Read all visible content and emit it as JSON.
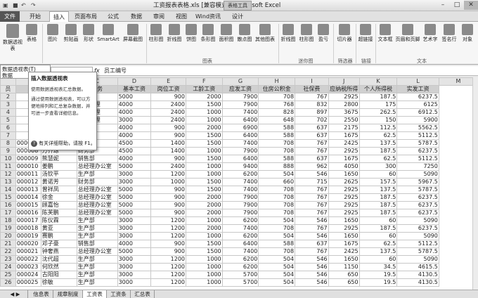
{
  "title": {
    "text": "工资报表表格.xls [兼容模式] - Microsoft Excel",
    "context": "表格工具"
  },
  "window": {
    "min": "–",
    "max": "□",
    "close": "✕"
  },
  "tabs": [
    "文件",
    "开始",
    "插入",
    "页面布局",
    "公式",
    "数据",
    "审阅",
    "视图",
    "Wind资讯",
    "设计"
  ],
  "ribbon": {
    "buttons": [
      "数据透视表",
      "表格",
      "图片",
      "剪贴画",
      "形状",
      "SmartArt",
      "屏幕截图",
      "柱形图",
      "折线图",
      "饼图",
      "条形图",
      "面积图",
      "散点图",
      "其他图表",
      "折线图",
      "柱形图",
      "盈亏",
      "切片器",
      "超链接",
      "文本框",
      "页眉和页脚",
      "艺术字",
      "签名行",
      "对象"
    ],
    "groups": [
      "图表",
      "迷你图",
      "筛选器",
      "链接",
      "文本"
    ]
  },
  "pivot_menu": {
    "item1": "数据透视表(T)",
    "item2": "数据"
  },
  "tooltip": {
    "title": "插入数据透视表",
    "l1": "使用数据透视表汇总数据。",
    "l2": "通过使用数据透视表，可以方便地排列和汇总复杂数据，并可进一步查看详细信息。",
    "help": "有关详细帮助，请按 F1。"
  },
  "formula": {
    "name_box": "",
    "fx": "fx",
    "value": "员工编号"
  },
  "columns": [
    "C",
    "D",
    "E",
    "F",
    "G",
    "H",
    "I",
    "J",
    "K",
    "L",
    "M"
  ],
  "headers": [
    "员",
    "",
    "所属部门",
    "职务",
    "基本工资",
    "岗位工资",
    "工龄工资",
    "应发工资",
    "住房公积金",
    "社保费",
    "应纳税所得",
    "个人所得税",
    "实发工资"
  ],
  "rows": [
    [
      "1",
      "",
      "",
      "",
      "",
      "",
      "",
      "",
      "",
      "",
      "",
      "",
      ""
    ],
    [
      "2",
      "",
      "总经理办公室",
      "文员",
      "5000",
      "900",
      "2000",
      "7900",
      "708",
      "767",
      "2925",
      "187.5",
      "6237.5"
    ],
    [
      "3",
      "",
      "",
      "部门经理",
      "4000",
      "2400",
      "1500",
      "7900",
      "768",
      "832",
      "2800",
      "175",
      "6125"
    ],
    [
      "4",
      "",
      "",
      "部门经理",
      "4000",
      "2400",
      "1000",
      "7400",
      "828",
      "897",
      "3675",
      "262.5",
      "6912.5"
    ],
    [
      "5",
      "",
      "",
      "部门经理",
      "3000",
      "2400",
      "1000",
      "6400",
      "648",
      "702",
      "2550",
      "150",
      "5900"
    ],
    [
      "6",
      "",
      "",
      "销售员",
      "4000",
      "900",
      "2000",
      "6900",
      "588",
      "637",
      "2175",
      "112.5",
      "5562.5"
    ],
    [
      "7",
      "",
      "",
      "销售员",
      "4000",
      "900",
      "1500",
      "6400",
      "588",
      "637",
      "1675",
      "62.5",
      "5112.5"
    ],
    [
      "8",
      "000007",
      "陈明",
      "财务部",
      "4500",
      "1400",
      "1500",
      "7400",
      "708",
      "767",
      "2425",
      "137.5",
      "5787.5"
    ],
    [
      "9",
      "000008",
      "万齐琼",
      "财务部",
      "4500",
      "1400",
      "1000",
      "7900",
      "708",
      "767",
      "2925",
      "187.5",
      "6237.5"
    ],
    [
      "10",
      "000009",
      "熊慧妮",
      "销售部",
      "4000",
      "900",
      "1500",
      "6400",
      "588",
      "637",
      "1675",
      "62.5",
      "5112.5"
    ],
    [
      "11",
      "000010",
      "姜鹏",
      "总经理办公室",
      "5000",
      "2400",
      "1000",
      "9400",
      "888",
      "962",
      "4050",
      "300",
      "7250"
    ],
    [
      "12",
      "000011",
      "汤钦平",
      "生产部",
      "3000",
      "1200",
      "1000",
      "6200",
      "504",
      "546",
      "1650",
      "60",
      "5090"
    ],
    [
      "13",
      "000012",
      "黄诺芳",
      "财务部",
      "3000",
      "1000",
      "1500",
      "7400",
      "660",
      "715",
      "2625",
      "157.5",
      "5967.5"
    ],
    [
      "14",
      "000013",
      "曾祥凤",
      "总经理办公室",
      "5000",
      "900",
      "1500",
      "7400",
      "708",
      "767",
      "2925",
      "137.5",
      "5787.5"
    ],
    [
      "15",
      "000014",
      "徐金",
      "总经理办公室",
      "5000",
      "900",
      "2000",
      "7900",
      "708",
      "767",
      "2925",
      "187.5",
      "6237.5"
    ],
    [
      "16",
      "000015",
      "顾嘉怡",
      "总经理办公室",
      "5000",
      "900",
      "2000",
      "7900",
      "708",
      "767",
      "2925",
      "187.5",
      "6237.5"
    ],
    [
      "17",
      "000016",
      "陈芙鹏",
      "总经理办公室",
      "5000",
      "900",
      "2000",
      "7900",
      "708",
      "767",
      "2925",
      "187.5",
      "6237.5"
    ],
    [
      "18",
      "000017",
      "陈仪霖",
      "生产部",
      "3000",
      "1200",
      "1000",
      "6200",
      "504",
      "546",
      "1650",
      "60",
      "5090"
    ],
    [
      "19",
      "000018",
      "黄亚",
      "生产部",
      "3000",
      "1200",
      "2000",
      "7400",
      "708",
      "767",
      "2925",
      "187.5",
      "6237.5"
    ],
    [
      "20",
      "000019",
      "赛鹏",
      "生产部",
      "3000",
      "1200",
      "1000",
      "6200",
      "504",
      "546",
      "1650",
      "60",
      "5090"
    ],
    [
      "21",
      "000020",
      "邓子豪",
      "销售部",
      "4000",
      "900",
      "1500",
      "6400",
      "588",
      "637",
      "1675",
      "62.5",
      "5112.5"
    ],
    [
      "22",
      "000021",
      "钟奢燕",
      "总经理办公室",
      "5000",
      "900",
      "1500",
      "7400",
      "708",
      "767",
      "2425",
      "137.5",
      "5787.5"
    ],
    [
      "23",
      "000022",
      "沈代超",
      "生产部",
      "3000",
      "1200",
      "1000",
      "6200",
      "504",
      "546",
      "1650",
      "60",
      "5090"
    ],
    [
      "24",
      "000023",
      "何欣然",
      "生产部",
      "3000",
      "1200",
      "1000",
      "6200",
      "504",
      "546",
      "1150",
      "34.5",
      "4615.5"
    ],
    [
      "25",
      "000024",
      "古阳阳",
      "生产部",
      "3000",
      "1200",
      "1000",
      "5700",
      "504",
      "546",
      "650",
      "19.5",
      "4130.5"
    ],
    [
      "26",
      "000025",
      "徐敏",
      "生产部",
      "3000",
      "1200",
      "1000",
      "5700",
      "504",
      "546",
      "650",
      "19.5",
      "4130.5"
    ]
  ],
  "sheets": [
    "信息表",
    "规章制度",
    "工资表",
    "工资条",
    "汇总表"
  ]
}
